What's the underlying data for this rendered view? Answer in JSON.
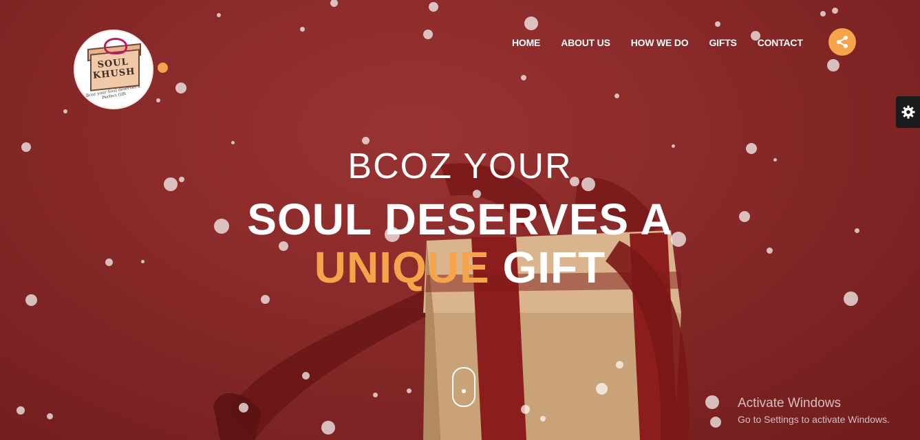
{
  "logo": {
    "name": "SOUL KHUSH",
    "tagline": "Bcoz your Soul deserves a Perfect Gift"
  },
  "nav": {
    "items": [
      "HOME",
      "ABOUT US",
      "HOW WE DO",
      "GIFTS",
      "CONTACT"
    ]
  },
  "hero": {
    "line1": "BCOZ YOUR",
    "line2": "SOUL DESERVES A",
    "line3_accent": "UNIQUE",
    "line3_rest": " GIFT"
  },
  "activation": {
    "title": "Activate Windows",
    "subtitle": "Go to Settings to activate Windows."
  },
  "colors": {
    "accent": "#f6a44b",
    "background": "#8a2a2a"
  }
}
